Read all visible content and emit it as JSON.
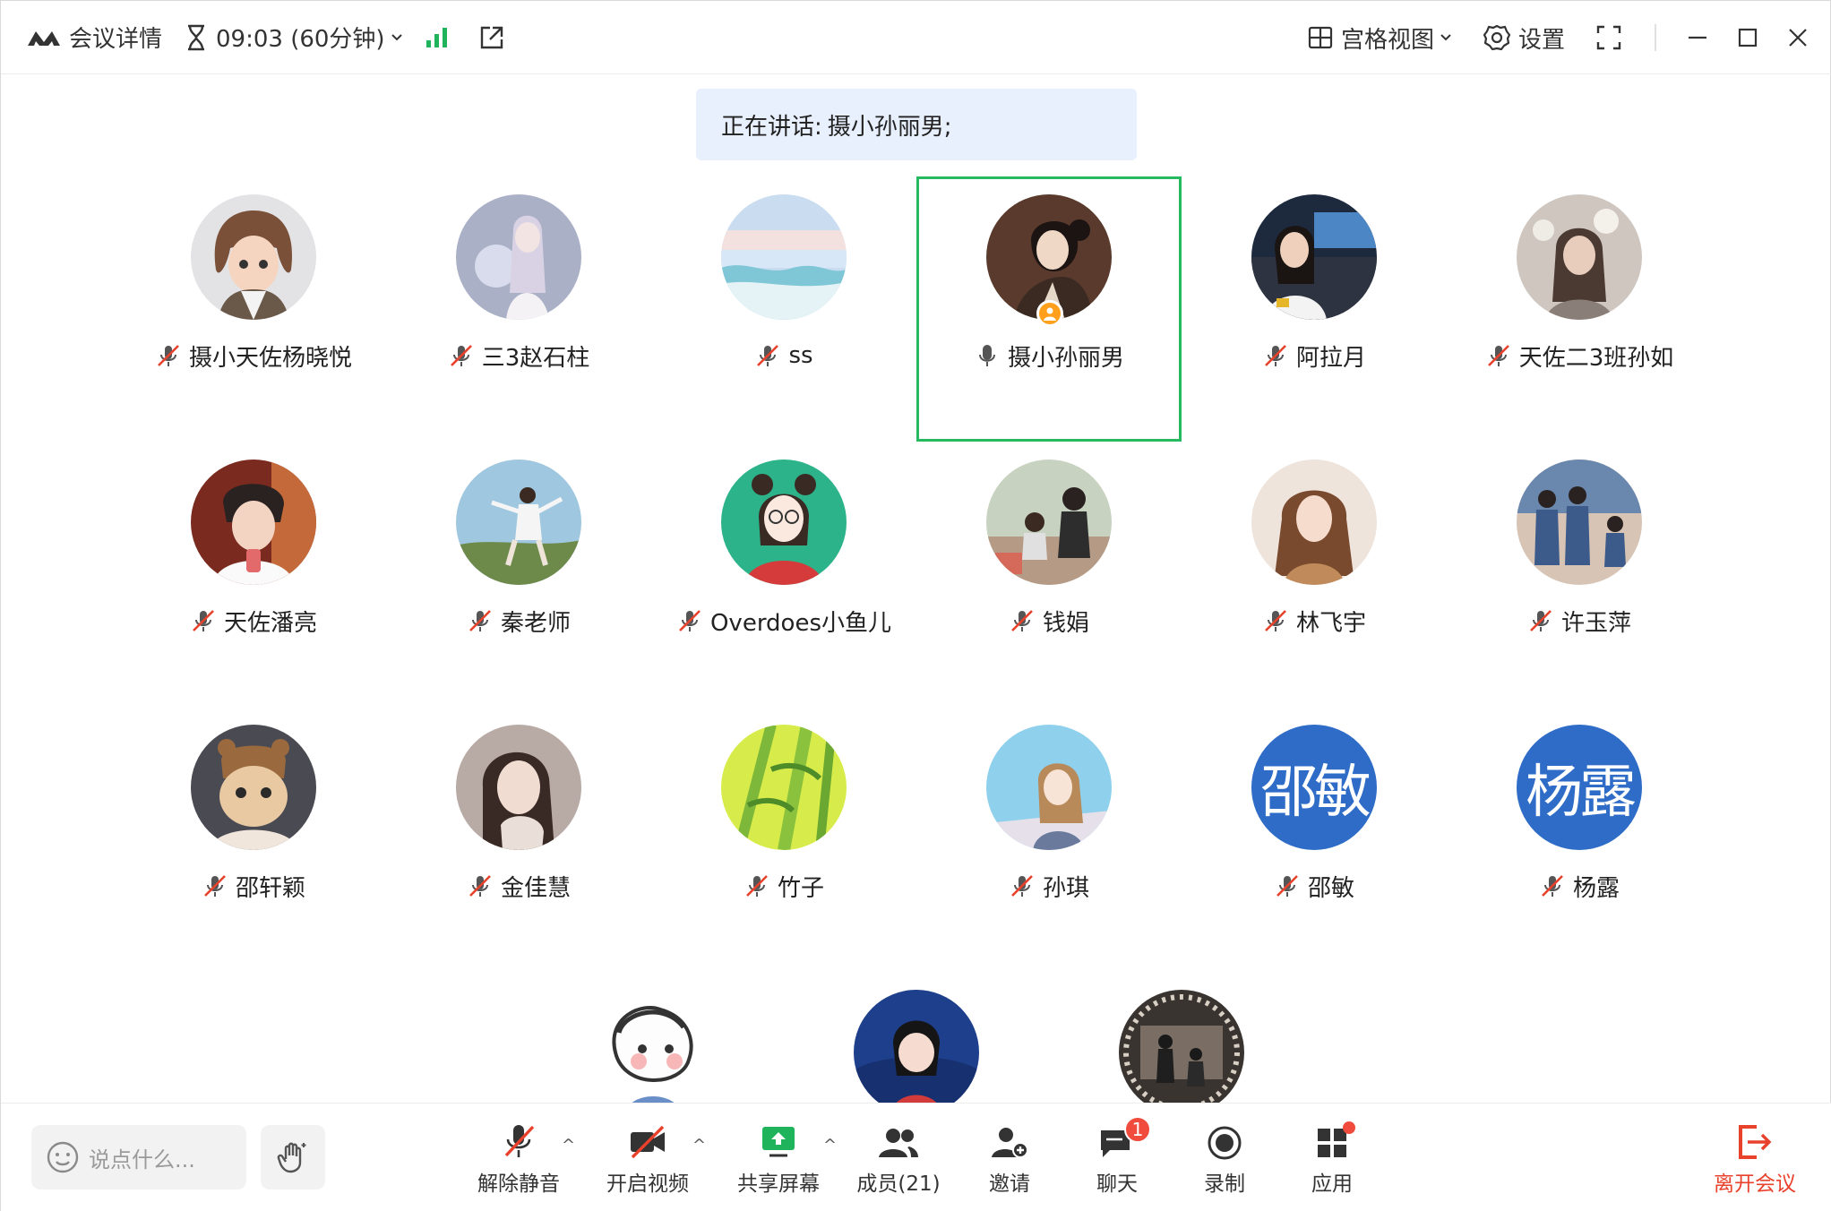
{
  "titlebar": {
    "meeting_details": "会议详情",
    "timer": "09:03 (60分钟)",
    "view_mode": "宫格视图",
    "settings": "设置"
  },
  "speaker_banner": {
    "prefix": "正在讲话:",
    "name": "摄小孙丽男;"
  },
  "participants": [
    {
      "name": "摄小天佐杨晓悦",
      "muted": true
    },
    {
      "name": "三3赵石柱",
      "muted": true
    },
    {
      "name": "ss",
      "muted": true
    },
    {
      "name": "摄小孙丽男",
      "muted": false,
      "speaking": true
    },
    {
      "name": "阿拉月",
      "muted": true
    },
    {
      "name": "天佐二3班孙如",
      "muted": true
    },
    {
      "name": "天佐潘亮",
      "muted": true
    },
    {
      "name": "秦老师",
      "muted": true
    },
    {
      "name": "Overdoes小鱼儿",
      "muted": true
    },
    {
      "name": "钱娟",
      "muted": true
    },
    {
      "name": "林飞宇",
      "muted": true
    },
    {
      "name": "许玉萍",
      "muted": true
    },
    {
      "name": "邵轩颖",
      "muted": true
    },
    {
      "name": "金佳慧",
      "muted": true
    },
    {
      "name": "竹子",
      "muted": true
    },
    {
      "name": "孙琪",
      "muted": true
    },
    {
      "name": "邵敏",
      "muted": true,
      "avatar_text": "邵敏"
    },
    {
      "name": "杨露",
      "muted": true,
      "avatar_text": "杨露"
    }
  ],
  "toolbar": {
    "chat_placeholder": "说点什么...",
    "unmute": "解除静音",
    "start_video": "开启视频",
    "share_screen": "共享屏幕",
    "members": "成员(21)",
    "invite": "邀请",
    "chat": "聊天",
    "chat_badge": "1",
    "record": "录制",
    "apps": "应用",
    "leave": "离开会议"
  },
  "colors": {
    "active_border": "#26b95f",
    "leave": "#e8412c",
    "accent_green": "#1fb35c",
    "banner": "#e8effd"
  }
}
